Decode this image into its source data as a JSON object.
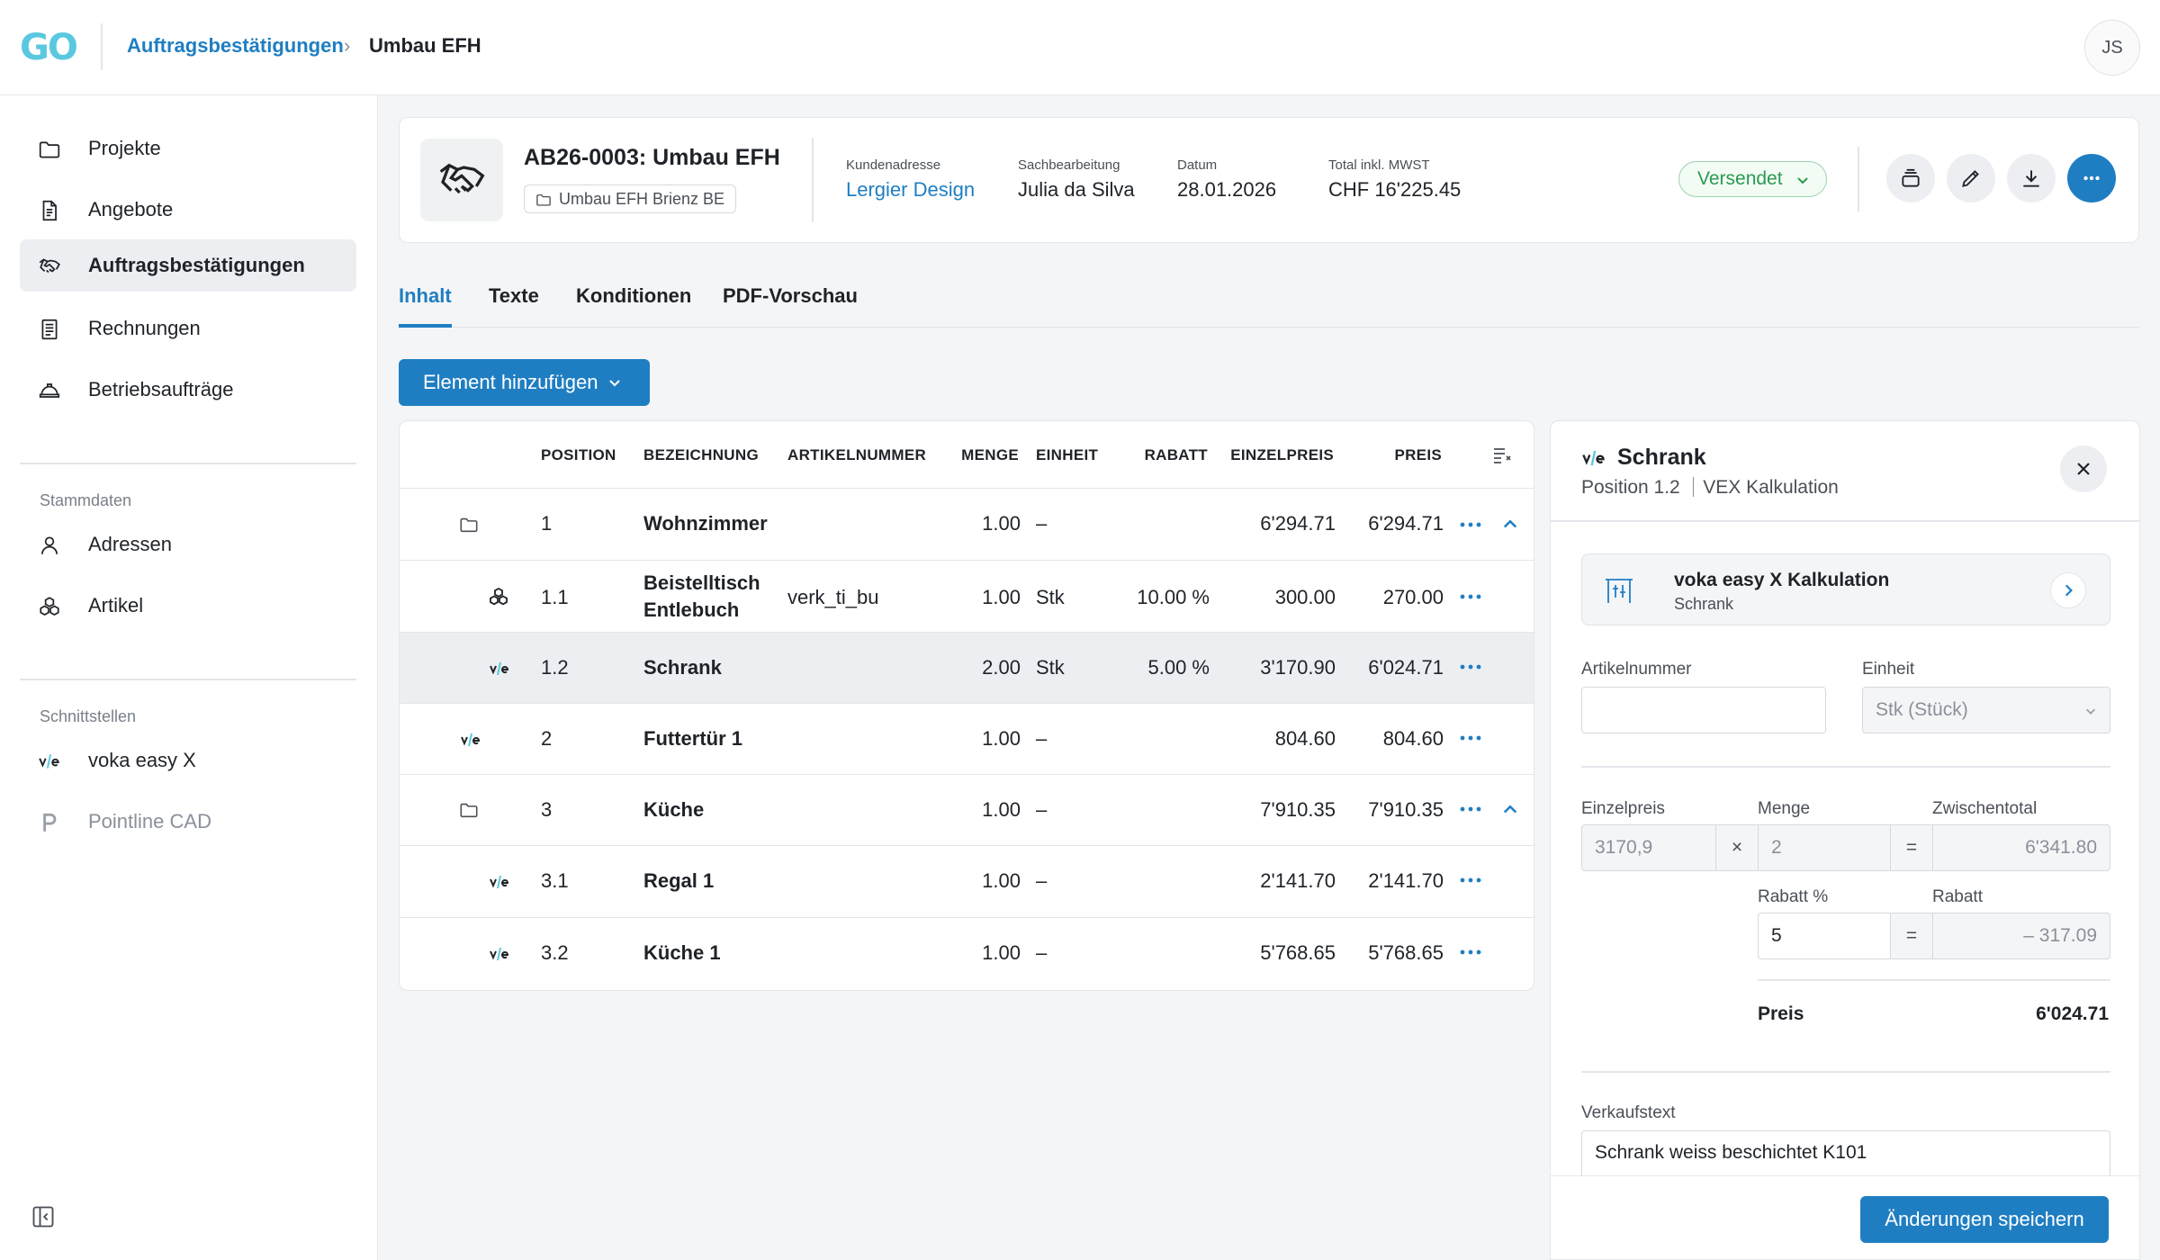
{
  "topbar": {
    "logo": "GO",
    "breadcrumb": [
      "Auftragsbestätigungen",
      "Umbau EFH"
    ],
    "breadcrumb_sep": "›",
    "avatar_initials": "JS"
  },
  "sidebar": {
    "items": [
      {
        "label": "Projekte",
        "icon": "folder-icon"
      },
      {
        "label": "Angebote",
        "icon": "document-icon"
      },
      {
        "label": "Auftragsbestätigungen",
        "icon": "handshake-icon",
        "active": true
      },
      {
        "label": "Rechnungen",
        "icon": "invoice-icon"
      },
      {
        "label": "Betriebsaufträge",
        "icon": "helmet-icon"
      }
    ],
    "stammdaten_title": "Stammdaten",
    "stammdaten": [
      {
        "label": "Adressen",
        "icon": "person-icon"
      },
      {
        "label": "Artikel",
        "icon": "articles-icon"
      }
    ],
    "schnittstellen_title": "Schnittstellen",
    "schnittstellen": [
      {
        "label": "voka easy X",
        "icon": "voka-icon"
      },
      {
        "label": "Pointline CAD",
        "icon": "pointline-icon",
        "muted": true
      }
    ]
  },
  "header": {
    "title": "AB26-0003: Umbau EFH",
    "project_chip": "Umbau EFH Brienz BE",
    "meta": [
      {
        "key": "Kundenadresse",
        "value": "Lergier Design",
        "link": true
      },
      {
        "key": "Sachbearbeitung",
        "value": "Julia da Silva"
      },
      {
        "key": "Datum",
        "value": "28.01.2026"
      },
      {
        "key": "Total inkl. MWST",
        "value": "CHF 16'225.45"
      }
    ],
    "status": "Versendet",
    "colors": {
      "accent": "#1f7ec2",
      "status_green": "#2b9a50"
    }
  },
  "tabs": [
    {
      "label": "Inhalt",
      "active": true
    },
    {
      "label": "Texte"
    },
    {
      "label": "Konditionen"
    },
    {
      "label": "PDF-Vorschau"
    }
  ],
  "add_button": "Element hinzufügen",
  "table": {
    "columns": [
      "POSITION",
      "BEZEICHNUNG",
      "ARTIKELNUMMER",
      "MENGE",
      "EINHEIT",
      "RABATT",
      "EINZELPREIS",
      "PREIS"
    ],
    "rows": [
      {
        "position": "1",
        "bezeichnung": "Wohnzimmer",
        "artikelnummer": "",
        "menge": "1.00",
        "einheit": "–",
        "rabatt": "",
        "einzelpreis": "6'294.71",
        "preis": "6'294.71",
        "icon": "folder-icon"
      },
      {
        "position": "1.1",
        "bezeichnung": "Beistelltisch",
        "bezeichnung2": "Entlebuch",
        "artikelnummer": "verk_ti_bu",
        "menge": "1.00",
        "einheit": "Stk",
        "rabatt": "10.00 %",
        "einzelpreis": "300.00",
        "preis": "270.00",
        "icon": "articles-icon"
      },
      {
        "position": "1.2",
        "bezeichnung": "Schrank",
        "artikelnummer": "",
        "menge": "2.00",
        "einheit": "Stk",
        "rabatt": "5.00 %",
        "einzelpreis": "3'170.90",
        "preis": "6'024.71",
        "icon": "voka-icon",
        "selected": true
      },
      {
        "position": "2",
        "bezeichnung": "Futtertür 1",
        "artikelnummer": "",
        "menge": "1.00",
        "einheit": "–",
        "rabatt": "",
        "einzelpreis": "804.60",
        "preis": "804.60",
        "icon": "voka-icon"
      },
      {
        "position": "3",
        "bezeichnung": "Küche",
        "artikelnummer": "",
        "menge": "1.00",
        "einheit": "–",
        "rabatt": "",
        "einzelpreis": "7'910.35",
        "preis": "7'910.35",
        "icon": "folder-icon"
      },
      {
        "position": "3.1",
        "bezeichnung": "Regal 1",
        "artikelnummer": "",
        "menge": "1.00",
        "einheit": "–",
        "rabatt": "",
        "einzelpreis": "2'141.70",
        "preis": "2'141.70",
        "icon": "voka-icon"
      },
      {
        "position": "3.2",
        "bezeichnung": "Küche 1",
        "artikelnummer": "",
        "menge": "1.00",
        "einheit": "–",
        "rabatt": "",
        "einzelpreis": "5'768.65",
        "preis": "5'768.65",
        "icon": "voka-icon"
      }
    ]
  },
  "panel": {
    "title": "Schrank",
    "subtitle_position": "Position 1.2",
    "subtitle_source": "VEX Kalkulation",
    "calc_title": "voka easy X Kalkulation",
    "calc_sub": "Schrank",
    "artikelnummer_label": "Artikelnummer",
    "artikelnummer_value": "",
    "einheit_label": "Einheit",
    "einheit_value": "Stk (Stück)",
    "einzelpreis_label": "Einzelpreis",
    "einzelpreis_value": "3170,9",
    "menge_label": "Menge",
    "menge_value": "2",
    "zwischentotal_label": "Zwischentotal",
    "zwischentotal_value": "6'341.80",
    "rabatt_pct_label": "Rabatt %",
    "rabatt_pct_value": "5",
    "rabatt_label": "Rabatt",
    "rabatt_value": "– 317.09",
    "op_mult": "×",
    "op_eq": "=",
    "preis_label": "Preis",
    "preis_value": "6'024.71",
    "verkaufstext_label": "Verkaufstext",
    "verkaufstext_value": "Schrank weiss beschichtet K101",
    "save_label": "Änderungen speichern"
  }
}
